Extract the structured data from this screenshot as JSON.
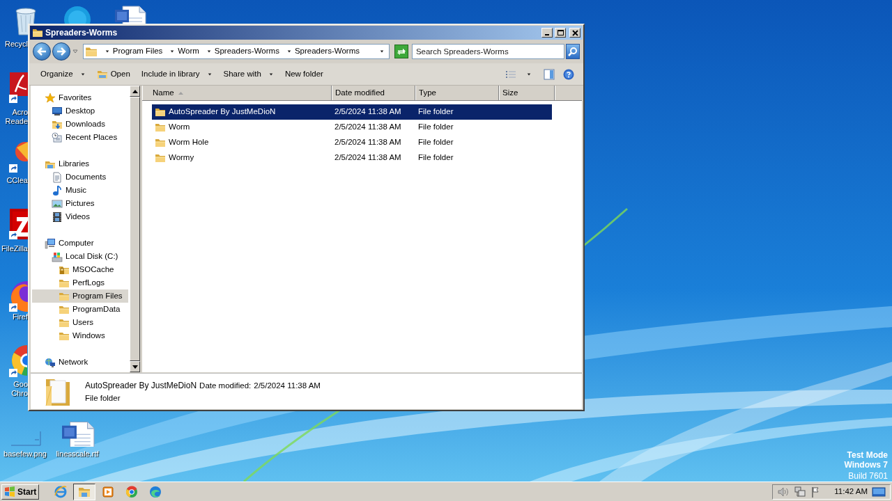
{
  "desktop": {
    "icons": [
      {
        "kind": "recycle-bin",
        "lines": [
          "Recycl"
        ]
      },
      {
        "kind": "round-app"
      },
      {
        "kind": "word"
      },
      {
        "kind": "acrobat",
        "lines": [
          "Acro",
          "Reade"
        ]
      },
      {
        "kind": "ccleaner",
        "lines": [
          "CClea"
        ]
      },
      {
        "kind": "filezilla",
        "lines": [
          "FileZilla"
        ]
      },
      {
        "kind": "firefox",
        "lines": [
          "Firef"
        ]
      },
      {
        "kind": "chrome",
        "lines": [
          "Goo",
          "Chro"
        ]
      },
      {
        "kind": "image-file",
        "lines": [
          "basefew.png"
        ]
      },
      {
        "kind": "word",
        "lines": [
          "linesscale.rtf"
        ]
      }
    ],
    "os_notice": [
      {
        "text": "Test Mode",
        "bold": true
      },
      {
        "text": "Windows 7",
        "bold": true
      },
      {
        "text": "Build 7601",
        "bold": false
      }
    ]
  },
  "window": {
    "title": "Spreaders-Worms",
    "breadcrumb": [
      "Program Files",
      "Worm",
      "Spreaders-Worms",
      "Spreaders-Worms"
    ],
    "search": {
      "placeholder": "Search Spreaders-Worms"
    },
    "toolbar": [
      {
        "label": "Organize",
        "kind": "menu"
      },
      {
        "label": "Open",
        "kind": "open"
      },
      {
        "label": "Include in library",
        "kind": "menu"
      },
      {
        "label": "Share with",
        "kind": "menu"
      },
      {
        "label": "New folder",
        "kind": "command"
      }
    ],
    "navigation": [
      {
        "label": "Favorites",
        "kind": "favorites",
        "selected": false,
        "children": [
          {
            "label": "Desktop",
            "kind": "desktop",
            "selected": false
          },
          {
            "label": "Downloads",
            "kind": "downloads",
            "selected": false
          },
          {
            "label": "Recent Places",
            "kind": "recent",
            "selected": false
          }
        ]
      },
      {
        "label": "Libraries",
        "kind": "libraries",
        "selected": false,
        "children": [
          {
            "label": "Documents",
            "kind": "documents",
            "selected": false
          },
          {
            "label": "Music",
            "kind": "music",
            "selected": false
          },
          {
            "label": "Pictures",
            "kind": "pictures",
            "selected": false
          },
          {
            "label": "Videos",
            "kind": "videos",
            "selected": false
          }
        ]
      },
      {
        "label": "Computer",
        "kind": "computer",
        "selected": false,
        "children": [
          {
            "label": "Local Disk (C:)",
            "kind": "disk",
            "selected": false,
            "children": [
              {
                "label": "MSOCache",
                "kind": "locked-folder",
                "selected": false
              },
              {
                "label": "PerfLogs",
                "kind": "folder",
                "selected": false
              },
              {
                "label": "Program Files",
                "kind": "folder",
                "selected": true
              },
              {
                "label": "ProgramData",
                "kind": "folder",
                "selected": false
              },
              {
                "label": "Users",
                "kind": "folder",
                "selected": false
              },
              {
                "label": "Windows",
                "kind": "folder",
                "selected": false
              }
            ]
          }
        ]
      },
      {
        "label": "Network",
        "kind": "network",
        "selected": false
      }
    ],
    "columns": [
      {
        "label": "Name",
        "sorted": true
      },
      {
        "label": "Date modified",
        "sorted": false
      },
      {
        "label": "Type",
        "sorted": false
      },
      {
        "label": "Size",
        "sorted": false
      }
    ],
    "rows": [
      {
        "name": "AutoSpreader By JustMeDioN",
        "date": "2/5/2024 11:38 AM",
        "type": "File folder",
        "selected": true
      },
      {
        "name": "Worm",
        "date": "2/5/2024 11:38 AM",
        "type": "File folder",
        "selected": false
      },
      {
        "name": "Worm Hole",
        "date": "2/5/2024 11:38 AM",
        "type": "File folder",
        "selected": false
      },
      {
        "name": "Wormy",
        "date": "2/5/2024 11:38 AM",
        "type": "File folder",
        "selected": false
      }
    ],
    "details": {
      "name": "AutoSpreader By JustMeDioN",
      "date_label": "Date modified:",
      "date": "2/5/2024 11:38 AM",
      "type": "File folder"
    }
  },
  "taskbar": {
    "start": "Start",
    "apps": [
      {
        "kind": "ie",
        "active": false
      },
      {
        "kind": "explorer",
        "active": true
      },
      {
        "kind": "media",
        "active": false
      },
      {
        "kind": "chrome",
        "active": false
      },
      {
        "kind": "edge",
        "active": false
      }
    ],
    "clock": "11:42 AM"
  }
}
